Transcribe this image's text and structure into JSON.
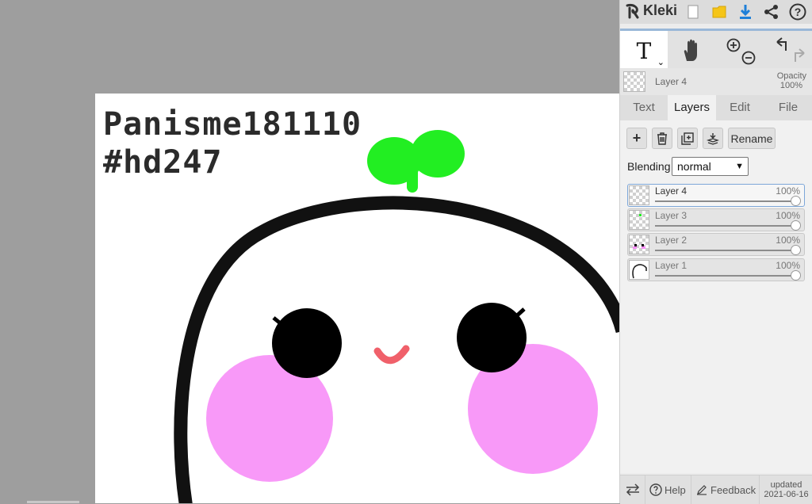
{
  "artwork": {
    "line1": "Panisme181110",
    "line2": "#hd247"
  },
  "panel": {
    "app_name": "Kleki",
    "top_icons": [
      "new-image-icon",
      "save-icon",
      "download-icon",
      "share-icon",
      "help-icon"
    ],
    "help_symbol": "?",
    "tool_letter": "T",
    "current_layer": {
      "name": "Layer 4",
      "opacity_label": "Opacity",
      "opacity_value": "100%"
    },
    "tabs": [
      {
        "label": "Text"
      },
      {
        "label": "Layers"
      },
      {
        "label": "Edit"
      },
      {
        "label": "File"
      }
    ],
    "active_tab": "Layers",
    "layer_buttons": {
      "add": "+",
      "rename": "Rename"
    },
    "blending": {
      "label": "Blending",
      "value": "normal"
    },
    "layers": [
      {
        "name": "Layer 4",
        "opacity": "100%"
      },
      {
        "name": "Layer 3",
        "opacity": "100%"
      },
      {
        "name": "Layer 2",
        "opacity": "100%"
      },
      {
        "name": "Layer 1",
        "opacity": "100%"
      }
    ],
    "bottom": {
      "help": "Help",
      "feedback": "Feedback",
      "updated_label": "updated",
      "updated_date": "2021-06-16"
    }
  },
  "colors": {
    "canvas_bg": "#9e9e9e",
    "sprout": "#22ee22",
    "blush": "#f78ef7",
    "mouth": "#f0606a",
    "accent_blue": "#1e7fd8",
    "save_yellow": "#f5c518"
  }
}
